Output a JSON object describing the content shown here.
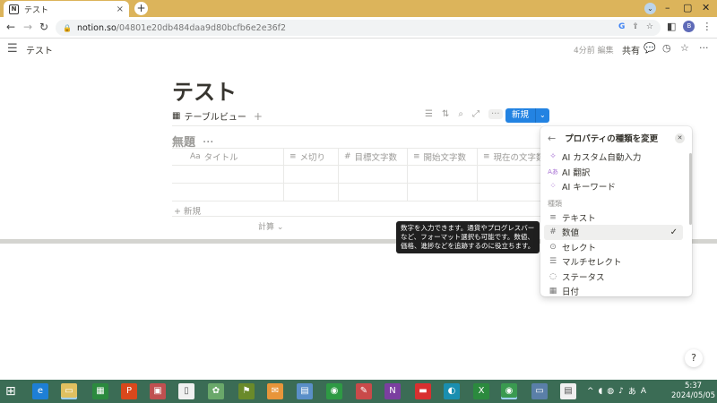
{
  "browser": {
    "tab_title": "テスト",
    "tab_favicon": "N",
    "close_glyph": "×",
    "newtab_glyph": "+",
    "url_host": "notion.so",
    "url_path": "/04801e20db484daa9d80bcfb6e2e36f2",
    "profile_initial": "B"
  },
  "notion_topbar": {
    "breadcrumb": "テスト",
    "edited": "4分前 編集",
    "share": "共有"
  },
  "page": {
    "title": "テスト",
    "view_tab": "テーブルビュー",
    "new_button": "新規",
    "db_title": "無題",
    "db_more": "···"
  },
  "table": {
    "columns": [
      {
        "icon": "Aa",
        "label": "タイトル"
      },
      {
        "icon": "≡",
        "label": "メ切り"
      },
      {
        "icon": "#",
        "label": "目標文字数"
      },
      {
        "icon": "≡",
        "label": "開始文字数"
      },
      {
        "icon": "≡",
        "label": "現在の文字数"
      }
    ],
    "add_row": "+ 新規",
    "calc": "計算 ⌄"
  },
  "tooltip": "数字を入力できます。通貨やプログレスバーなど、フォーマット選択も可能です。数値、価格、進捗などを追跡するのに役立ちます。",
  "popup": {
    "title": "プロパティの種類を変更",
    "ai_items": [
      {
        "icon": "✧",
        "label": "AI カスタム自動入力"
      },
      {
        "icon": "Aあ",
        "label": "AI 翻訳"
      },
      {
        "icon": "⁘",
        "label": "AI キーワード"
      }
    ],
    "section_label": "種類",
    "type_items": [
      {
        "icon": "≡",
        "label": "テキスト",
        "selected": false
      },
      {
        "icon": "#",
        "label": "数値",
        "selected": true
      },
      {
        "icon": "⊙",
        "label": "セレクト",
        "selected": false
      },
      {
        "icon": "☰",
        "label": "マルチセレクト",
        "selected": false
      },
      {
        "icon": "◌",
        "label": "ステータス",
        "selected": false
      },
      {
        "icon": "▦",
        "label": "日付",
        "selected": false
      }
    ],
    "check": "✓"
  },
  "help_label": "?",
  "taskbar": {
    "time": "5:37",
    "date": "2024/05/05",
    "ime": "あ",
    "lang": "A"
  },
  "colors": {
    "accent": "#2383e2",
    "tabstrip": "#dcb45b",
    "taskbar": "#3b6c55"
  }
}
